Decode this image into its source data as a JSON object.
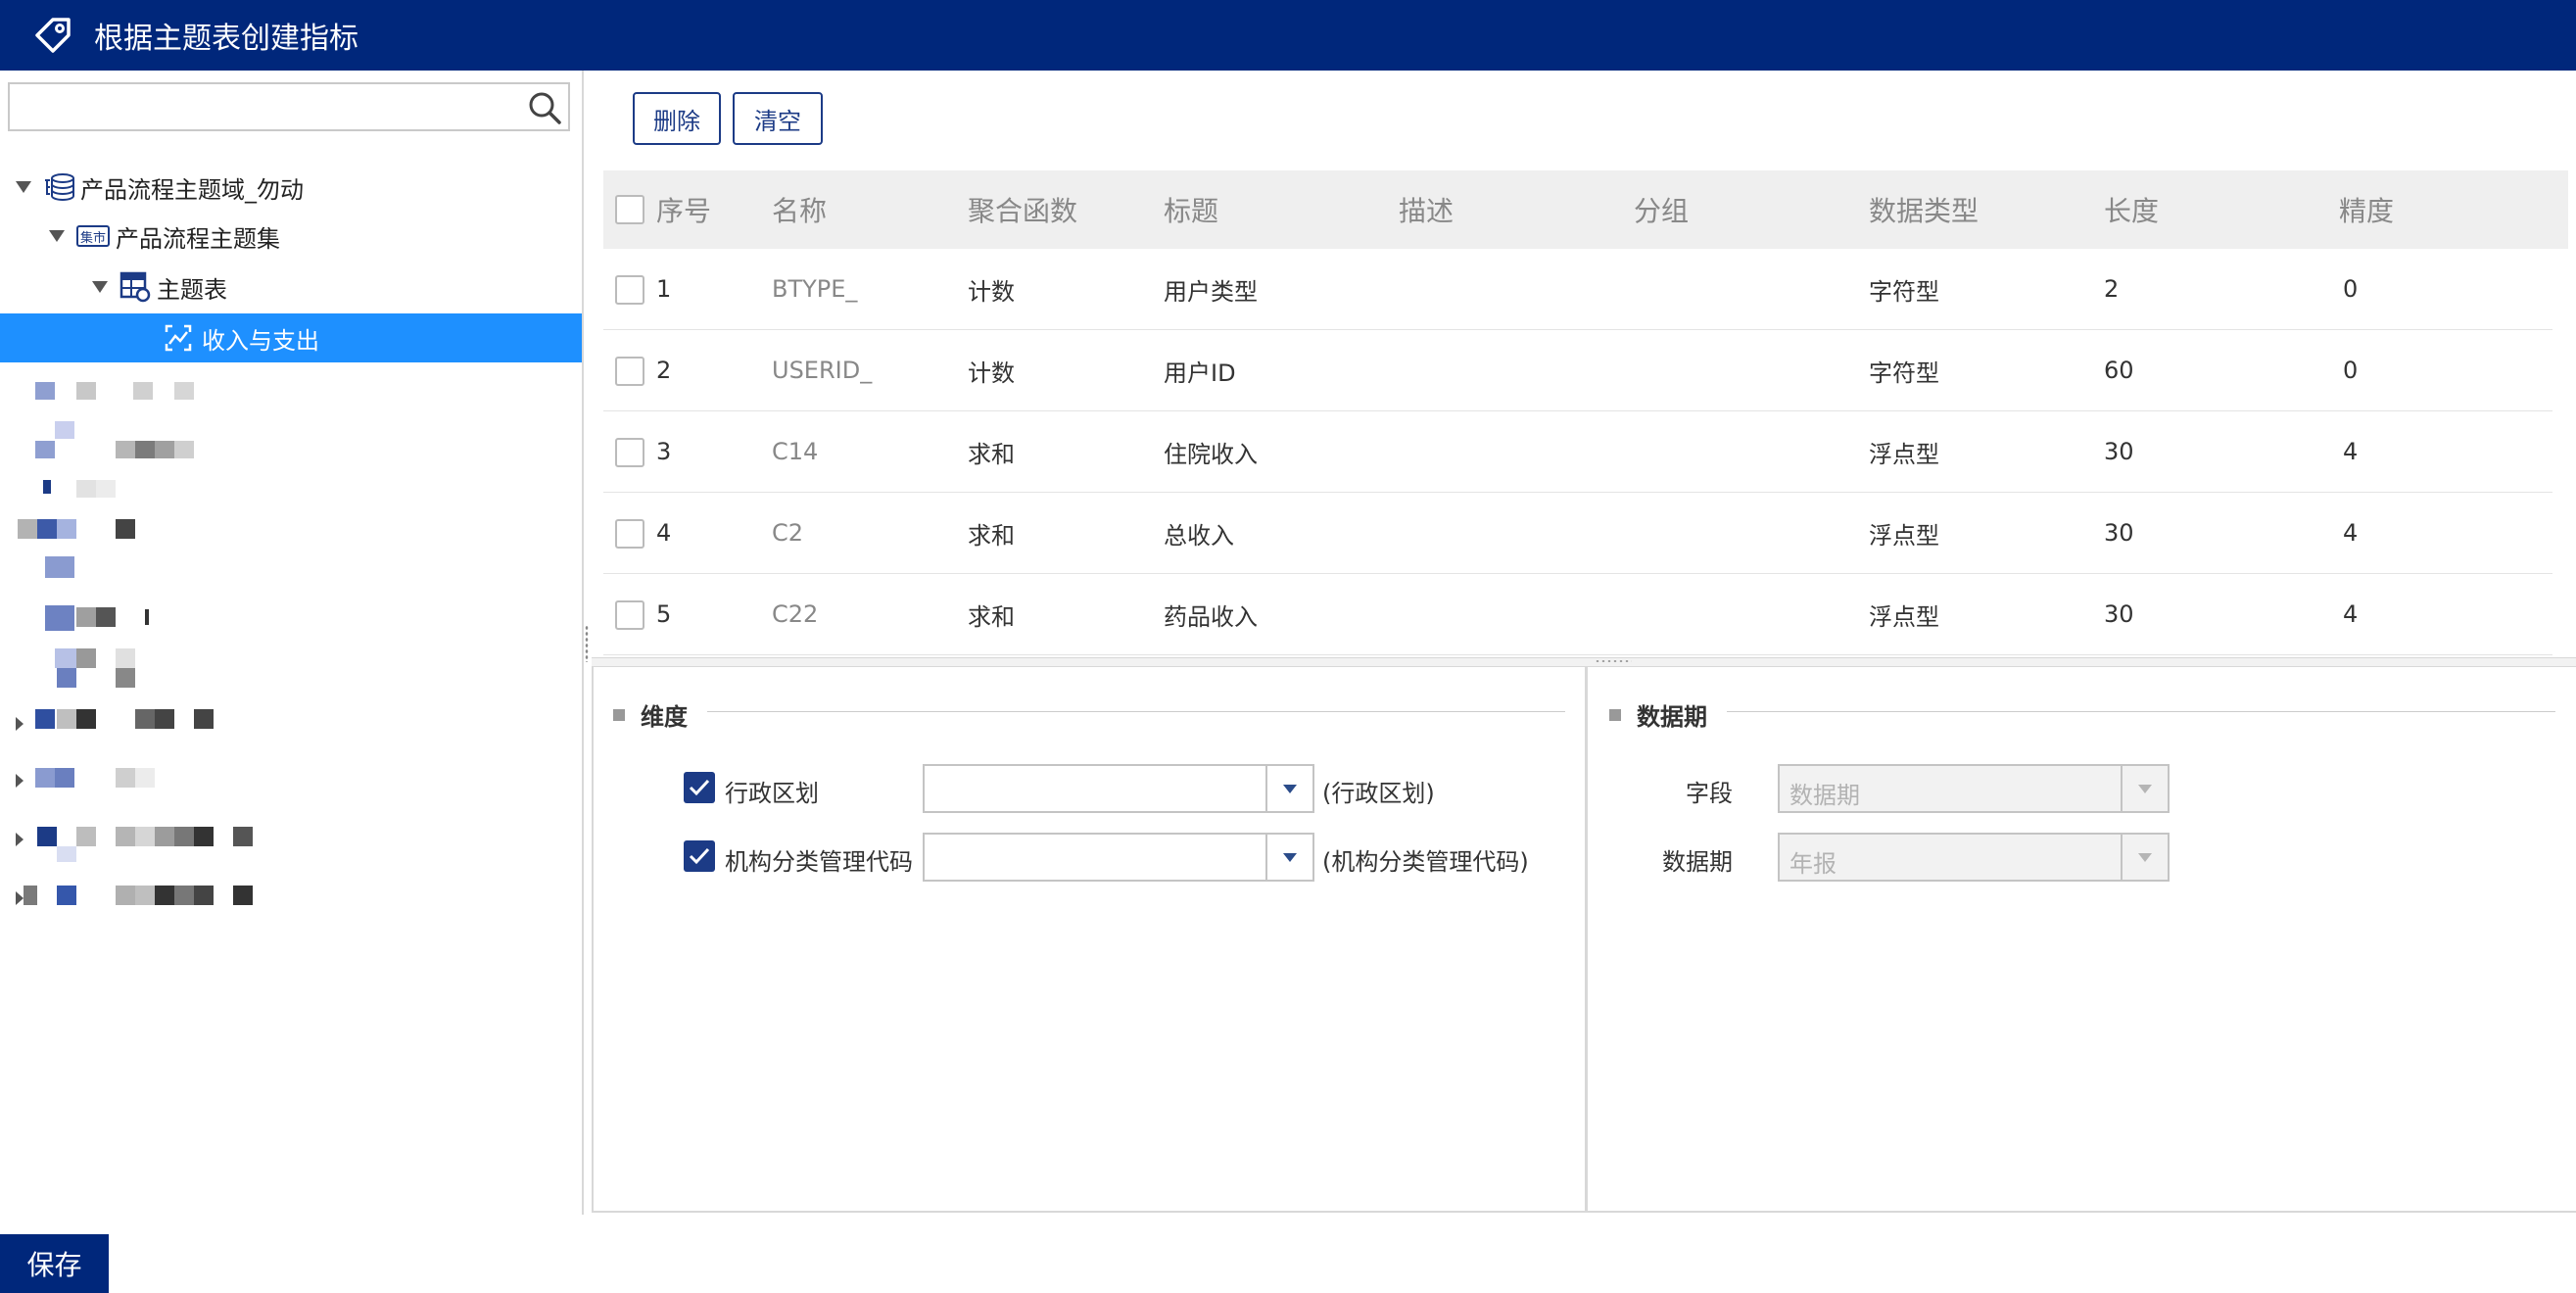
{
  "window": {
    "title": "根据主题表创建指标"
  },
  "search": {
    "placeholder": ""
  },
  "tree": {
    "domain": "产品流程主题域_勿动",
    "set_icon_text": "集市",
    "set": "产品流程主题集",
    "table": "主题表",
    "selected": "收入与支出"
  },
  "toolbar": {
    "delete_label": "删除",
    "clear_label": "清空"
  },
  "table": {
    "headers": [
      "序号",
      "名称",
      "聚合函数",
      "标题",
      "描述",
      "分组",
      "数据类型",
      "长度",
      "精度"
    ],
    "rows": [
      {
        "no": "1",
        "name": "BTYPE_",
        "agg": "计数",
        "title": "用户类型",
        "desc": "",
        "group": "",
        "type": "字符型",
        "len": "2",
        "prec": "0"
      },
      {
        "no": "2",
        "name": "USERID_",
        "agg": "计数",
        "title": "用户ID",
        "desc": "",
        "group": "",
        "type": "字符型",
        "len": "60",
        "prec": "0"
      },
      {
        "no": "3",
        "name": "C14",
        "agg": "求和",
        "title": "住院收入",
        "desc": "",
        "group": "",
        "type": "浮点型",
        "len": "30",
        "prec": "4"
      },
      {
        "no": "4",
        "name": "C2",
        "agg": "求和",
        "title": "总收入",
        "desc": "",
        "group": "",
        "type": "浮点型",
        "len": "30",
        "prec": "4"
      },
      {
        "no": "5",
        "name": "C22",
        "agg": "求和",
        "title": "药品收入",
        "desc": "",
        "group": "",
        "type": "浮点型",
        "len": "30",
        "prec": "4"
      }
    ]
  },
  "dimension": {
    "title": "维度",
    "items": [
      {
        "label": "行政区划",
        "value": "",
        "hint": "(行政区划)",
        "checked": true
      },
      {
        "label": "机构分类管理代码",
        "value": "",
        "hint": "(机构分类管理代码)",
        "checked": true
      }
    ]
  },
  "period": {
    "title": "数据期",
    "field_label": "字段",
    "field_value": "数据期",
    "period_label": "数据期",
    "period_value": "年报"
  },
  "footer": {
    "save_label": "保存"
  },
  "colors": {
    "brand": "#00277b",
    "selected": "#1e90ff",
    "button_border": "#1c3b86"
  }
}
